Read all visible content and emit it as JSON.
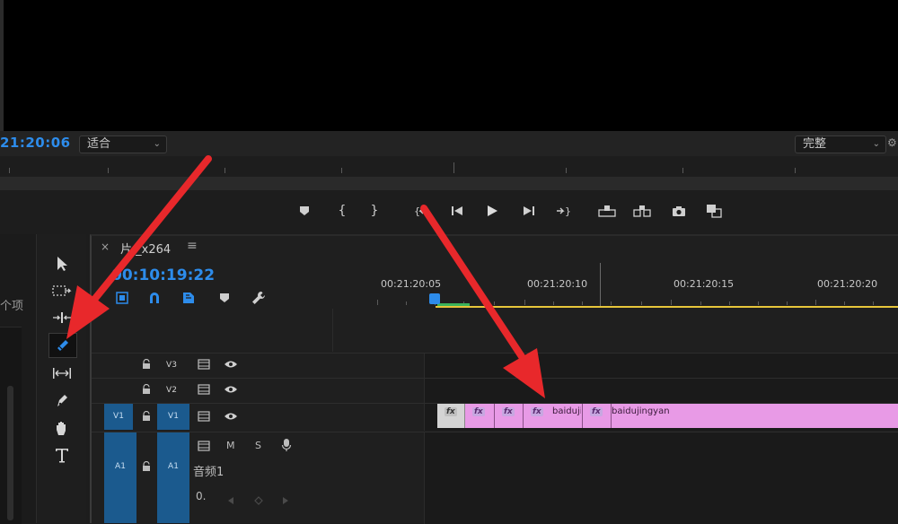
{
  "program_monitor": {
    "timecode": "21:20:06",
    "zoom_select": "适合",
    "quality_select": "完整"
  },
  "timeline": {
    "tab_close": "×",
    "tab_title": "片 _x264",
    "tab_menu": "≡",
    "timecode": "00:10:19:22",
    "ruler_labels": [
      "00:21:20:05",
      "00:21:20:10",
      "00:21:20:15",
      "00:21:20:20"
    ],
    "tracks": {
      "v3": "V3",
      "v2": "V2",
      "v1_source": "V1",
      "v1": "V1",
      "a1_source": "A1",
      "a1": "A1",
      "audio_m": "M",
      "audio_s": "S",
      "audio_name": "音频1",
      "audio_volume": "0."
    },
    "clips": {
      "fx": "fx",
      "label1": "baiduji",
      "label2": "baidujingyan"
    }
  },
  "left_panel": {
    "partial_text": "个项"
  },
  "colors": {
    "accent_blue": "#2d8ceb",
    "clip_pink": "#e89ae6",
    "arrow_red": "#e8282b",
    "in_out_yellow": "#e6c53a"
  }
}
